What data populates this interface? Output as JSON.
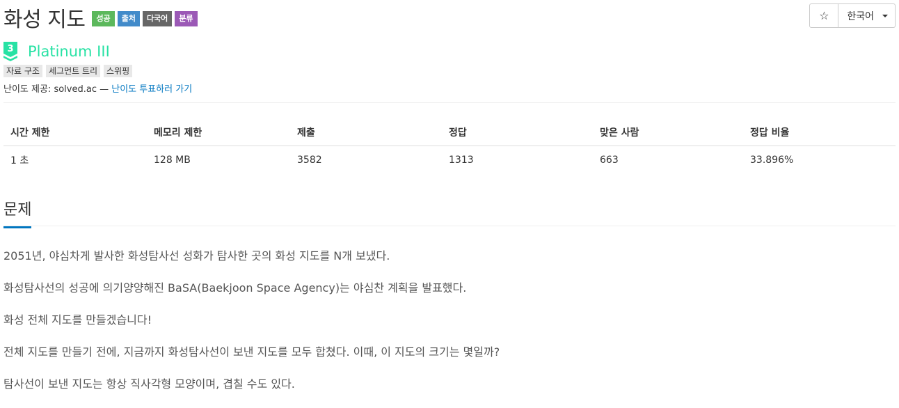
{
  "problem": {
    "title": "화성 지도",
    "badges": [
      "성공",
      "출처",
      "다국어",
      "분류"
    ],
    "tier": "Platinum III",
    "tier_level": "3",
    "tags": [
      "자료 구조",
      "세그먼트 트리",
      "스위핑"
    ],
    "provider_label": "난이도 제공: solved.ac —",
    "vote_link": "난이도 투표하러 가기"
  },
  "toolbar": {
    "star_icon": "star-icon",
    "star_glyph": "☆",
    "language": "한국어"
  },
  "stats": {
    "headers": [
      "시간 제한",
      "메모리 제한",
      "제출",
      "정답",
      "맞은 사람",
      "정답 비율"
    ],
    "values": [
      "1 초",
      "128 MB",
      "3582",
      "1313",
      "663",
      "33.896%"
    ]
  },
  "section": {
    "title": "문제",
    "paragraphs": [
      "2051년, 야심차게 발사한 화성탐사선 성화가 탐사한 곳의 화성 지도를 N개 보냈다.",
      "화성탐사선의 성공에 의기양양해진 BaSA(Baekjoon Space Agency)는 야심찬 계획을 발표했다.",
      "화성 전체 지도를 만들겠습니다!",
      "전체 지도를 만들기 전에, 지금까지 화성탐사선이 보낸 지도를 모두 합쳤다. 이때, 이 지도의 크기는 몇일까?",
      "탐사선이 보낸 지도는 항상 직사각형 모양이며, 겹칠 수도 있다."
    ]
  },
  "colors": {
    "tier": "#27e2a4",
    "link": "#0076c0",
    "badge_green": "#5cb85c",
    "badge_blue": "#428bca",
    "badge_gray": "#666666",
    "badge_purple": "#9b59b6"
  }
}
